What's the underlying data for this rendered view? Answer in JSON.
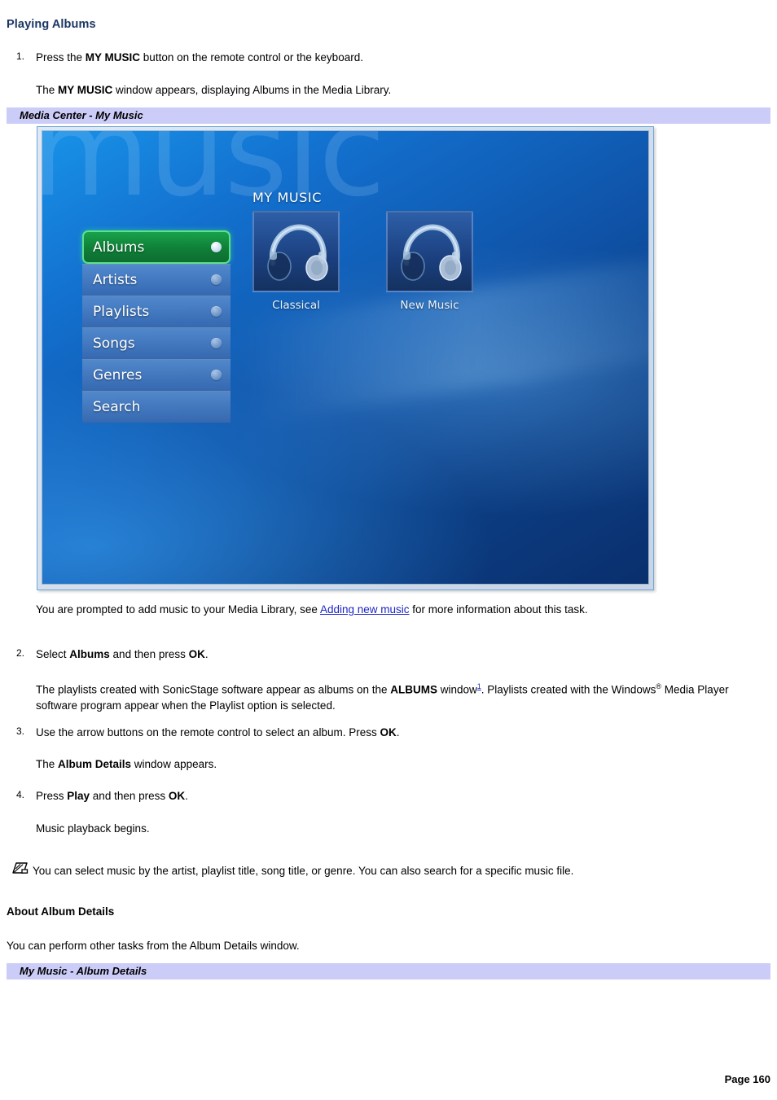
{
  "page": {
    "heading": "Playing Albums",
    "footer": "Page 160"
  },
  "steps": [
    {
      "num": "1.",
      "text_pre": "Press the ",
      "bold1": "MY MUSIC",
      "text_post": " button on the remote control or the keyboard."
    },
    {
      "num": "2.",
      "text_pre": "Select ",
      "bold1": "Albums",
      "text_mid": " and then press ",
      "bold2": "OK",
      "text_post": "."
    },
    {
      "num": "3.",
      "text_pre": "Use the arrow buttons on the remote control to select an album. Press ",
      "bold1": "OK",
      "text_post": "."
    },
    {
      "num": "4.",
      "text_pre": "Press ",
      "bold1": "Play",
      "text_mid": " and then press ",
      "bold2": "OK",
      "text_post": "."
    }
  ],
  "paragraphs": {
    "after_step1_pre": "The ",
    "after_step1_bold": "MY MUSIC",
    "after_step1_post": " window appears, displaying Albums in the Media Library.",
    "prompt_pre": "You are prompted to add music to your Media Library, see ",
    "prompt_link": "Adding new music",
    "prompt_post": " for more information about this task.",
    "sonicstage_pre": "The playlists created with SonicStage software appear as albums on the ",
    "sonicstage_bold": "ALBUMS",
    "sonicstage_mid": " window",
    "sonicstage_footnote": "1",
    "sonicstage_post": ". Playlists created with the Windows",
    "sonicstage_reg": "®",
    "sonicstage_end": " Media Player software program appear when the Playlist option is selected.",
    "album_details_pre": "The ",
    "album_details_bold": "Album Details",
    "album_details_post": " window appears.",
    "playback": "Music playback begins.",
    "note": "You can select music by the artist, playlist title, song title, or genre. You can also search for a specific music file.",
    "about_heading": "About Album Details",
    "about_body": "You can perform other tasks from the Album Details window."
  },
  "captions": {
    "figure1": "Media Center - My Music",
    "figure2": "My Music - Album Details"
  },
  "screenshot": {
    "watermark": "music",
    "title": "MY MUSIC",
    "menu": [
      {
        "label": "Albums",
        "selected": true,
        "dot": true
      },
      {
        "label": "Artists",
        "selected": false,
        "dot": true
      },
      {
        "label": "Playlists",
        "selected": false,
        "dot": true
      },
      {
        "label": "Songs",
        "selected": false,
        "dot": true
      },
      {
        "label": "Genres",
        "selected": false,
        "dot": true
      },
      {
        "label": "Search",
        "selected": false,
        "dot": false
      }
    ],
    "albums": [
      {
        "label": "Classical"
      },
      {
        "label": "New Music"
      }
    ]
  },
  "colors": {
    "heading_blue": "#1b3664",
    "caption_bar": "#ccccf9",
    "link_blue": "#1c24c4",
    "selected_green": "#0f7f38"
  }
}
